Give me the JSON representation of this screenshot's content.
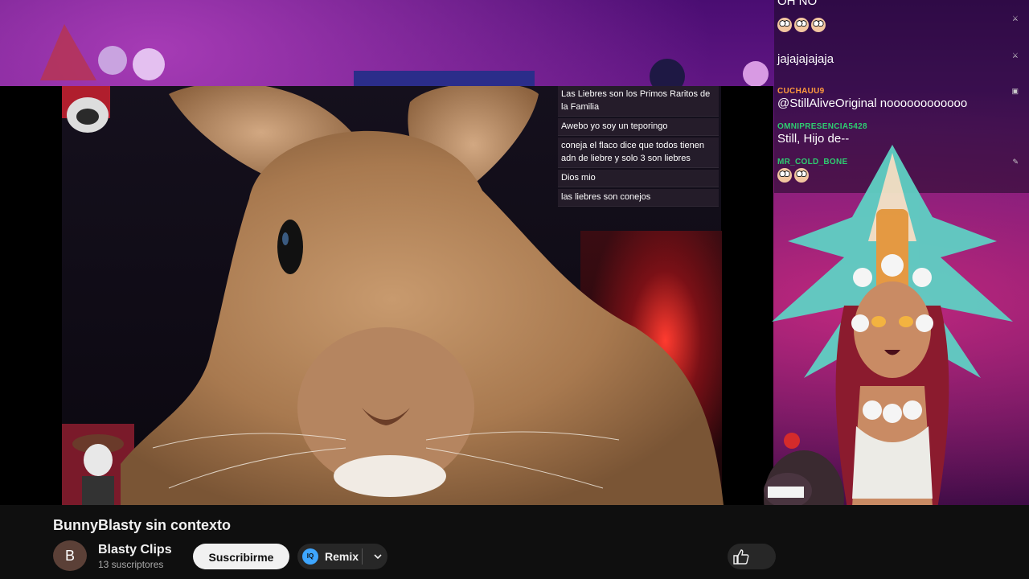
{
  "stream_chat": {
    "top_cut_text": "OH NO",
    "messages": [
      {
        "user": "",
        "text": "",
        "emotes": 3,
        "color": "#e53935"
      },
      {
        "user": "",
        "text": "jajajajajaja",
        "emotes": 0,
        "color": "#e53935"
      },
      {
        "user": "CUCHAUU9",
        "text": "@StillAliveOriginal noooooooooooo",
        "emotes": 0,
        "color": "#ff9a3c"
      },
      {
        "user": "OMNIPRESENCIA5428",
        "text": "Still, Hijo de--",
        "emotes": 0,
        "color": "#2ecc71"
      },
      {
        "user": "MR_COLD_BONE",
        "text": "",
        "emotes": 2,
        "color": "#2ecc71"
      }
    ]
  },
  "video_chat": {
    "messages": [
      {
        "text": "Las Liebres son los Primos Raritos de la Familia"
      },
      {
        "text": "Awebo yo soy un teporingo"
      },
      {
        "text": "coneja el flaco dice que todos tienen adn de liebre y solo 3 son liebres"
      },
      {
        "text": "Dios mio"
      },
      {
        "text": "las liebres son conejos"
      }
    ]
  },
  "video": {
    "title": "BunnyBlasty sin contexto"
  },
  "channel": {
    "avatar_letter": "B",
    "name": "Blasty Clips",
    "subscribers": "13 suscriptores"
  },
  "actions": {
    "subscribe_label": "Suscribirme",
    "remix_label": "Remix",
    "remix_badge": "IQ"
  },
  "colors": {
    "accent_blue": "#3ea6ff",
    "background": "#0f0f0f",
    "subscribe_bg": "#f1f1f1"
  }
}
